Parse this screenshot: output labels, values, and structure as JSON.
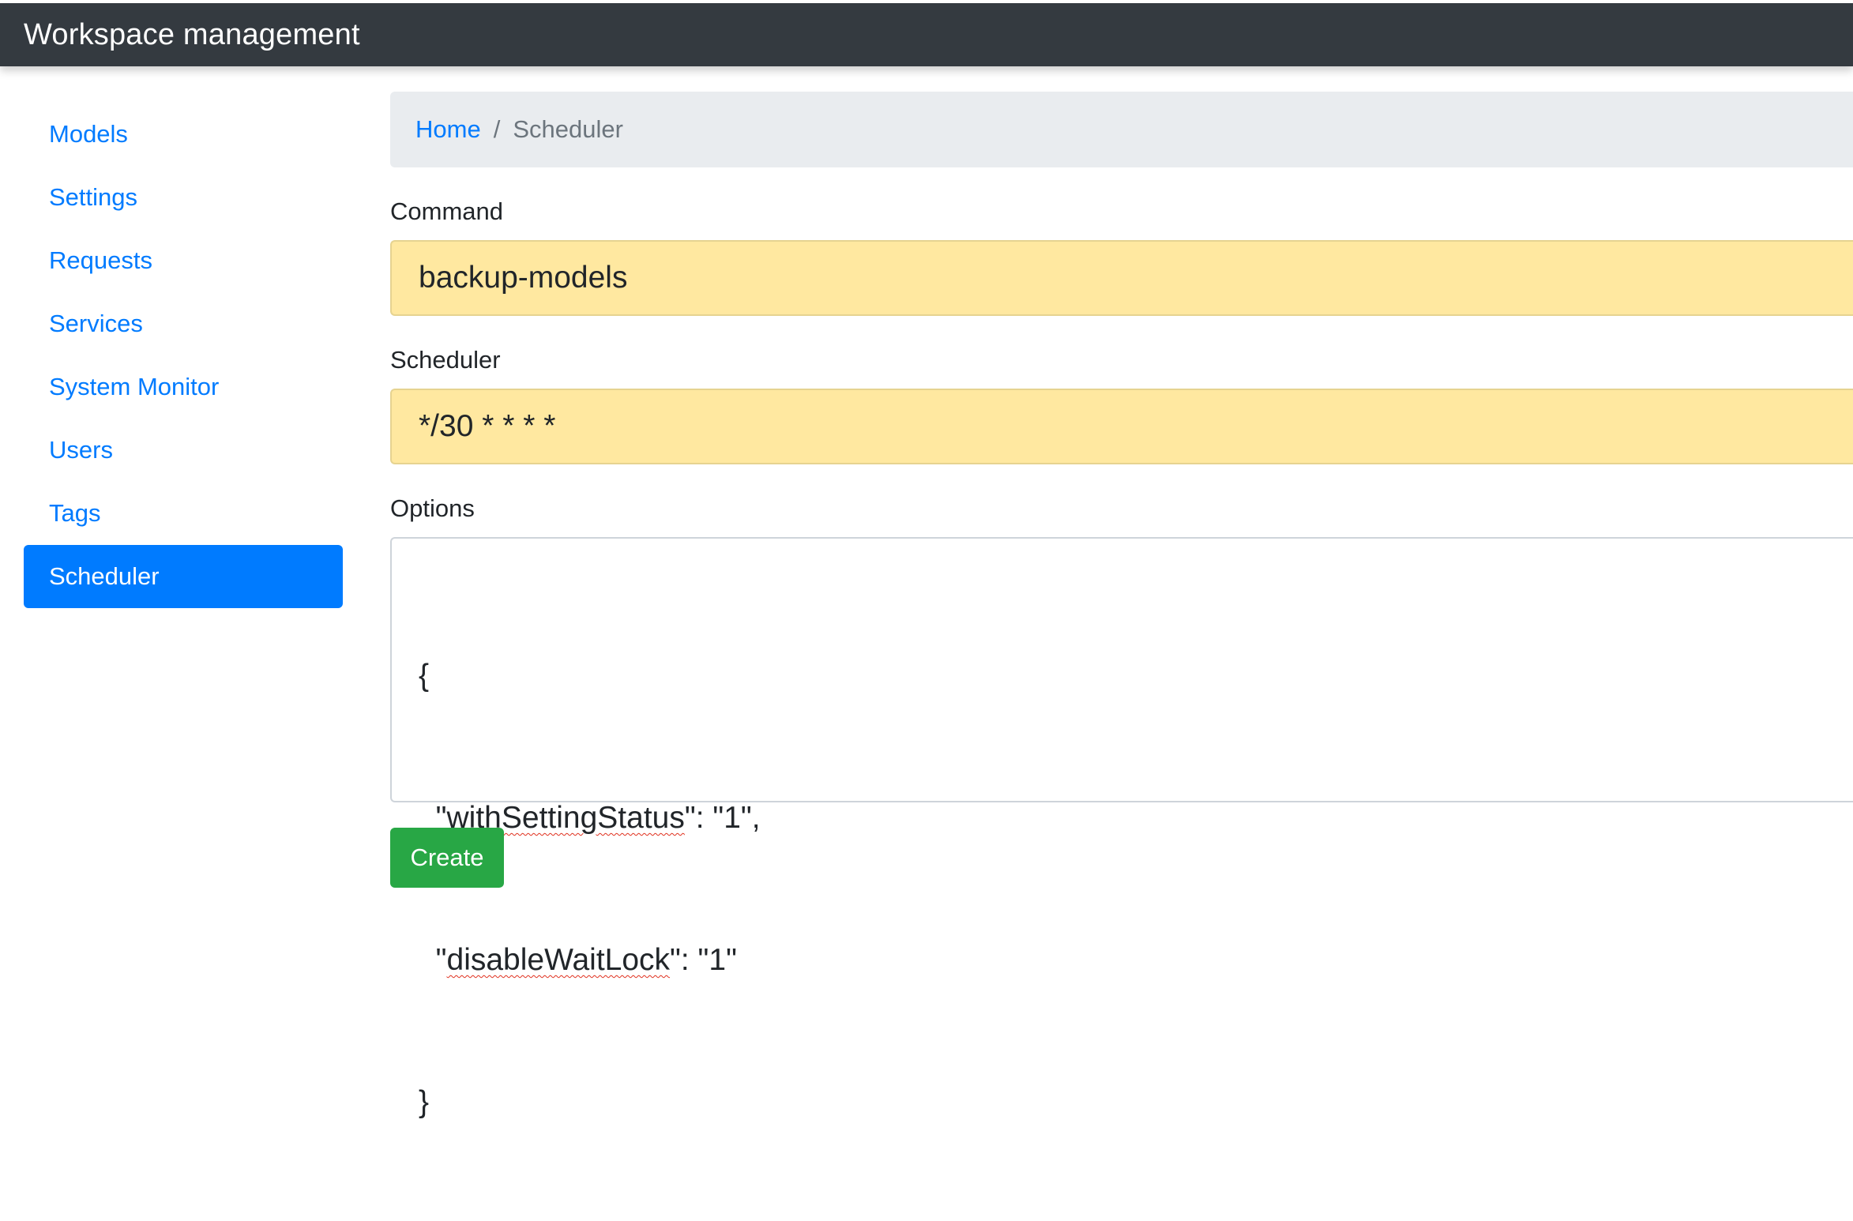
{
  "app": {
    "title": "Workspace management"
  },
  "sidebar": {
    "items": [
      {
        "label": "Models"
      },
      {
        "label": "Settings"
      },
      {
        "label": "Requests"
      },
      {
        "label": "Services"
      },
      {
        "label": "System Monitor"
      },
      {
        "label": "Users"
      },
      {
        "label": "Tags"
      },
      {
        "label": "Scheduler"
      }
    ],
    "active": "Scheduler"
  },
  "breadcrumb": {
    "home": "Home",
    "separator": "/",
    "current": "Scheduler"
  },
  "form": {
    "command_label": "Command",
    "command_value": "backup-models",
    "scheduler_label": "Scheduler",
    "scheduler_value": "*/30 * * * *",
    "options_label": "Options",
    "options_lines": {
      "open": "{",
      "line1_quote_open": "  \"",
      "line1_key": "withSettingStatus",
      "line1_rest": "\": \"1\",",
      "line2_quote_open": "  \"",
      "line2_key": "disableWaitLock",
      "line2_rest": "\": \"1\"",
      "close": "}"
    },
    "create_label": "Create"
  },
  "colors": {
    "navbar_bg": "#343a40",
    "link": "#007bff",
    "active_bg": "#007bff",
    "input_autofill_bg": "#ffe8a0",
    "success": "#28a745"
  }
}
